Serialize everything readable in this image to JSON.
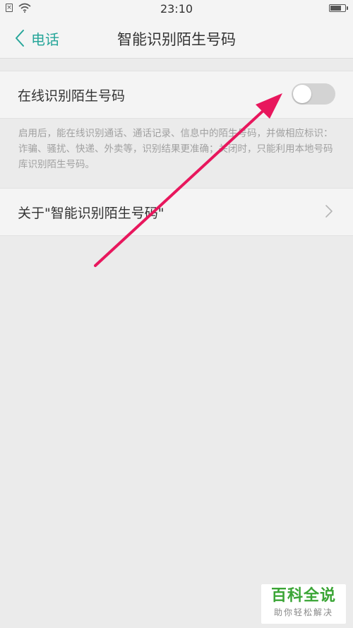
{
  "status_bar": {
    "time": "23:10",
    "sim_icon": "sim-x-icon",
    "wifi_icon": "wifi-icon",
    "battery_icon": "battery-icon",
    "battery_level": 0.8
  },
  "header": {
    "back_label": "电话",
    "title": "智能识别陌生号码"
  },
  "toggle_setting": {
    "label": "在线识别陌生号码",
    "enabled": false
  },
  "description": "启用后，能在线识别通话、通话记录、信息中的陌生号码，并做相应标识：诈骗、骚扰、快递、外卖等，识别结果更准确；关闭时，只能利用本地号码库识别陌生号码。",
  "about_item": {
    "label": "关于\"智能识别陌生号码\""
  },
  "watermark": {
    "title": "百科全说",
    "subtitle": "助你轻松解决"
  },
  "colors": {
    "accent": "#27a69a",
    "annotation": "#e8175d",
    "background": "#ebebeb",
    "row_background": "#f4f4f4",
    "switch_off": "#d3d3d3",
    "watermark_green": "#3aa535"
  }
}
